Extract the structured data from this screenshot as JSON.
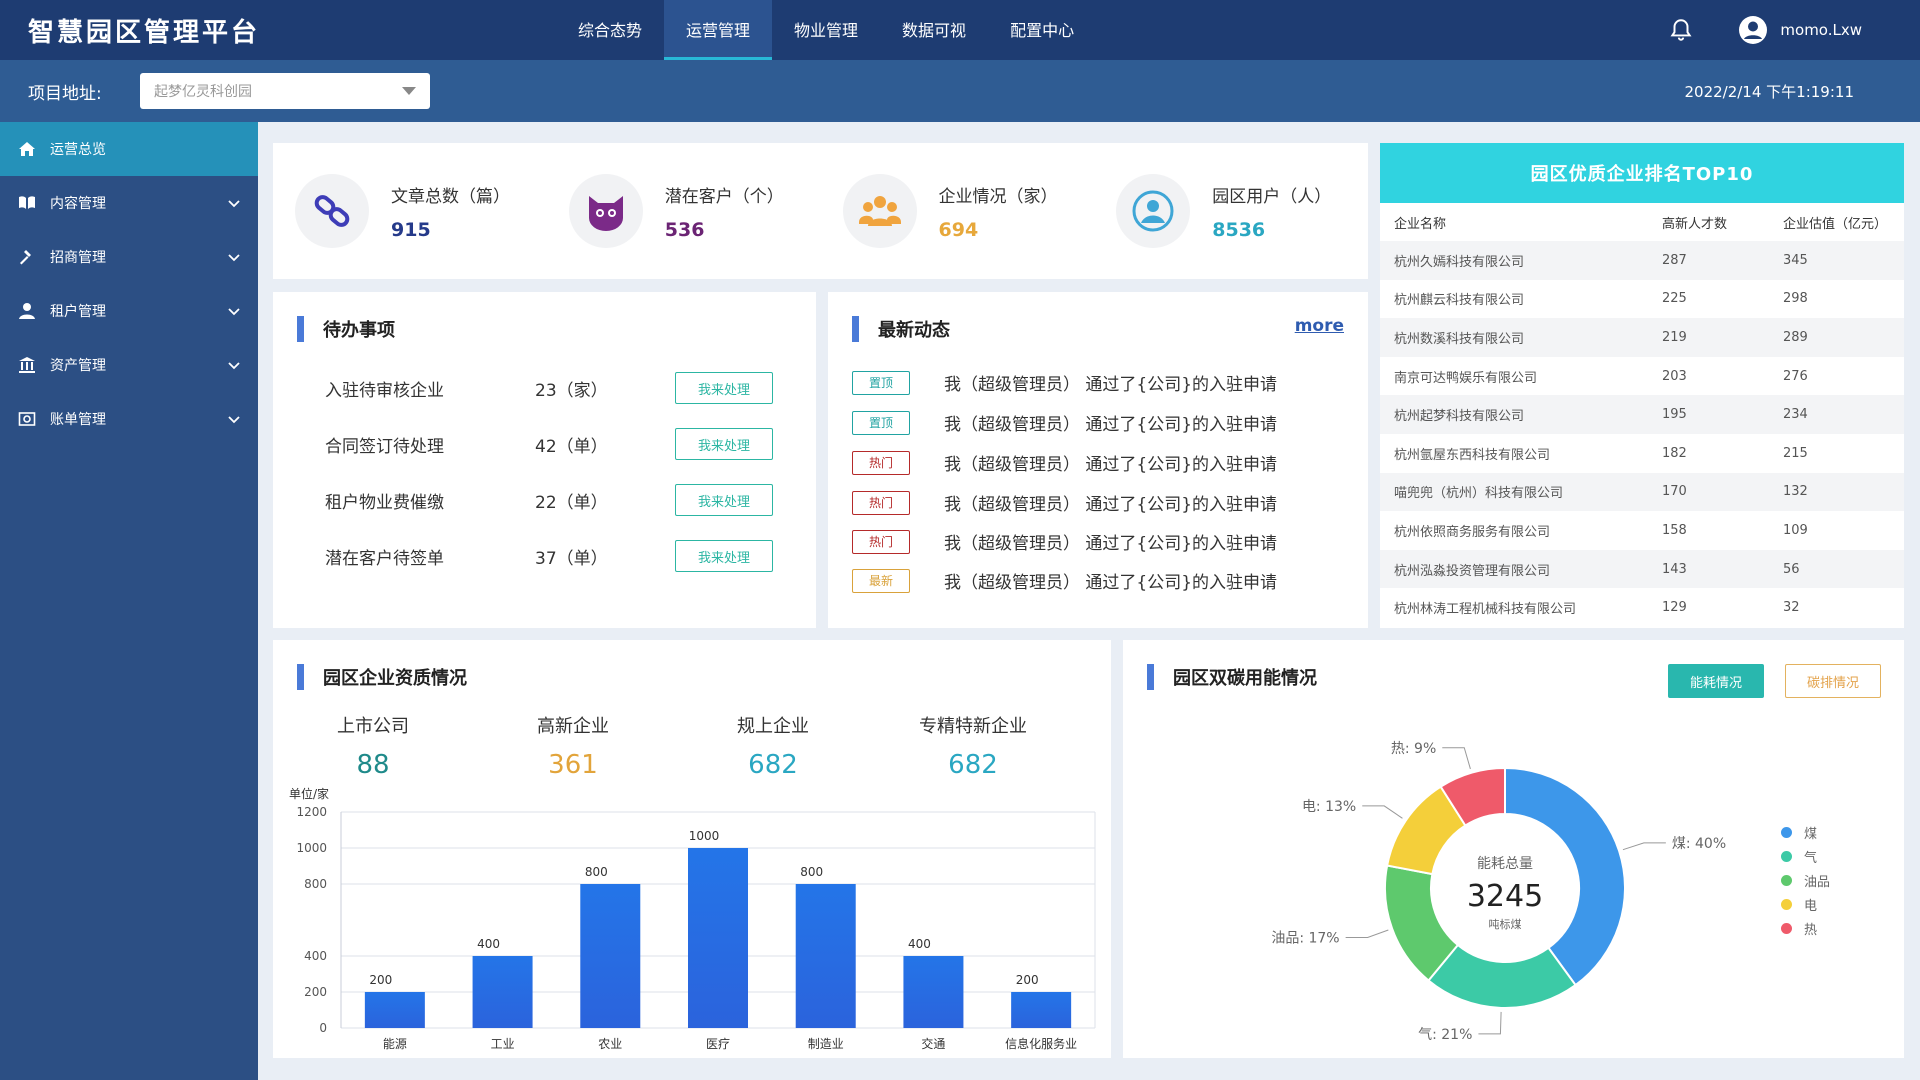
{
  "header": {
    "title": "智慧园区管理平台",
    "tabs": [
      {
        "label": "综合态势"
      },
      {
        "label": "运营管理"
      },
      {
        "label": "物业管理"
      },
      {
        "label": "数据可视"
      },
      {
        "label": "配置中心"
      }
    ],
    "username": "momo.Lxw"
  },
  "subheader": {
    "project_label": "项目地址:",
    "project_value": "起梦亿灵科创园",
    "datetime": "2022/2/14 下午1:19:11"
  },
  "sidebar": {
    "items": [
      {
        "label": "运营总览"
      },
      {
        "label": "内容管理"
      },
      {
        "label": "招商管理"
      },
      {
        "label": "租户管理"
      },
      {
        "label": "资产管理"
      },
      {
        "label": "账单管理"
      }
    ]
  },
  "stats": [
    {
      "label": "文章总数（篇）",
      "value": "915",
      "color": "#253a8a"
    },
    {
      "label": "潜在客户（个）",
      "value": "536",
      "color": "#6b2474"
    },
    {
      "label": "企业情况（家）",
      "value": "694",
      "color": "#e7a83b"
    },
    {
      "label": "园区用户（人）",
      "value": "8536",
      "color": "#2aa7c2"
    }
  ],
  "todo": {
    "title": "待办事项",
    "button_label": "我来处理",
    "rows": [
      {
        "name": "入驻待审核企业",
        "value": "23（家）"
      },
      {
        "name": "合同签订待处理",
        "value": "42（单）"
      },
      {
        "name": "租户物业费催缴",
        "value": "22（单）"
      },
      {
        "name": "潜在客户待签单",
        "value": "37（单）"
      }
    ]
  },
  "news": {
    "title": "最新动态",
    "more": "more",
    "rows": [
      {
        "tag": "置顶",
        "text": "我（超级管理员） 通过了{公司}的入驻申请"
      },
      {
        "tag": "置顶",
        "text": "我（超级管理员） 通过了{公司}的入驻申请"
      },
      {
        "tag": "热门",
        "text": "我（超级管理员） 通过了{公司}的入驻申请"
      },
      {
        "tag": "热门",
        "text": "我（超级管理员） 通过了{公司}的入驻申请"
      },
      {
        "tag": "热门",
        "text": "我（超级管理员） 通过了{公司}的入驻申请"
      },
      {
        "tag": "最新",
        "text": "我（超级管理员） 通过了{公司}的入驻申请"
      }
    ]
  },
  "ranking": {
    "title": "园区优质企业排名TOP10",
    "headers": [
      "企业名称",
      "高新人才数",
      "企业估值（亿元）"
    ],
    "rows": [
      [
        "杭州久嫣科技有限公司",
        "287",
        "345"
      ],
      [
        "杭州麒云科技有限公司",
        "225",
        "298"
      ],
      [
        "杭州数溪科技有限公司",
        "219",
        "289"
      ],
      [
        "南京可达鸭娱乐有限公司",
        "203",
        "276"
      ],
      [
        "杭州起梦科技有限公司",
        "195",
        "234"
      ],
      [
        "杭州氩屋东西科技有限公司",
        "182",
        "215"
      ],
      [
        "喵兜兜（杭州）科技有限公司",
        "170",
        "132"
      ],
      [
        "杭州依照商务服务有限公司",
        "158",
        "109"
      ],
      [
        "杭州泓淼投资管理有限公司",
        "143",
        "56"
      ],
      [
        "杭州林涛工程机械科技有限公司",
        "129",
        "32"
      ]
    ]
  },
  "qualification": {
    "title": "园区企业资质情况",
    "items": [
      {
        "label": "上市公司",
        "value": "88",
        "color": "#1f8a8a"
      },
      {
        "label": "高新企业",
        "value": "361",
        "color": "#e2a43a"
      },
      {
        "label": "规上企业",
        "value": "682",
        "color": "#2aa7c2"
      },
      {
        "label": "专精特新企业",
        "value": "682",
        "color": "#2aa7c2"
      }
    ],
    "unit": "单位/家"
  },
  "energy": {
    "title": "园区双碳用能情况",
    "btn_primary": "能耗情况",
    "btn_secondary": "碳排情况",
    "center_label": "能耗总量",
    "center_value": "3245",
    "center_unit": "吨标煤"
  },
  "chart_data": [
    {
      "type": "bar",
      "categories": [
        "能源",
        "工业",
        "农业",
        "医疗",
        "制造业",
        "交通",
        "信息化服务业"
      ],
      "values": [
        200,
        400,
        800,
        1000,
        800,
        400,
        200
      ],
      "title": "",
      "xlabel": "",
      "ylabel": "单位/家",
      "ylim": [
        0,
        1200
      ],
      "yticks": [
        0,
        200,
        400,
        800,
        1000,
        1200
      ],
      "bar_color": "#2f6fe0",
      "grid": true
    },
    {
      "type": "pie",
      "donut": true,
      "slices": [
        {
          "name": "煤",
          "label": "煤: 40%",
          "value": 40,
          "color": "#3d97ea"
        },
        {
          "name": "气",
          "label": "气: 21%",
          "value": 21,
          "color": "#3ccaa6"
        },
        {
          "name": "油品",
          "label": "油品: 17%",
          "value": 17,
          "color": "#5ec96d"
        },
        {
          "name": "电",
          "label": "电: 13%",
          "value": 13,
          "color": "#f4cf3a"
        },
        {
          "name": "热",
          "label": "热: 9%",
          "value": 9,
          "color": "#ef5a6a"
        }
      ],
      "legend": "right"
    }
  ]
}
